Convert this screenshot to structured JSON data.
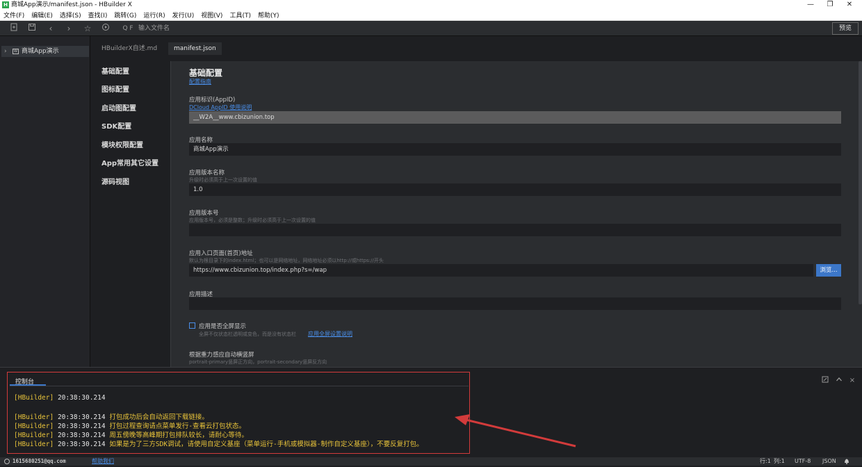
{
  "window": {
    "logo_text": "H",
    "title": "商城App演示/manifest.json - HBuilder X",
    "controls": [
      "—",
      "❐",
      "✕"
    ]
  },
  "menu": [
    "文件(F)",
    "编辑(E)",
    "选择(S)",
    "查找(I)",
    "跳转(G)",
    "运行(R)",
    "发行(U)",
    "视图(V)",
    "工具(T)",
    "帮助(Y)"
  ],
  "toolbar": {
    "search_shortcut": "Q F",
    "search_placeholder": "输入文件名",
    "preview_label": "预览"
  },
  "sidebar": {
    "project_name": "商城App演示",
    "folder_badge": "W"
  },
  "tabs": [
    {
      "label": "HBuilderX自述.md",
      "active": false
    },
    {
      "label": "manifest.json",
      "active": true
    }
  ],
  "settings_nav": [
    "基础配置",
    "图标配置",
    "启动图配置",
    "SDK配置",
    "模块权限配置",
    "App常用其它设置",
    "源码视图"
  ],
  "form": {
    "heading": "基础配置",
    "guide_link": "配置指南",
    "appid": {
      "label": "应用标识(AppID)",
      "link": "DCloud AppID 使用说明",
      "value": "__W2A__www.cbizunion.top"
    },
    "name": {
      "label": "应用名称",
      "value": "商城App演示"
    },
    "version_name": {
      "label": "应用版本名称",
      "hint": "升级时必须高于上一次设置的值",
      "value": "1.0"
    },
    "version_code": {
      "label": "应用版本号",
      "hint": "应用版本号，必须是整数；升级时必须高于上一次设置的值",
      "value": ""
    },
    "entry_url": {
      "label": "应用入口页面(首页)地址",
      "hint": "默认为根目录下的index.html；也可以是网络地址，网络地址必须以http://或https://开头",
      "value": "https://www.cbizunion.top/index.php?s=/wap",
      "browse_label": "浏览..."
    },
    "description": {
      "label": "应用描述",
      "value": ""
    },
    "fullscreen": {
      "label": "应用是否全屏显示",
      "hint": "全屏不仅状态栏透明或变色，而是没有状态栏",
      "link": "应用全屏设置说明",
      "checked": false
    },
    "orientation": {
      "label": "根据重力感应自动横竖屏",
      "hint": "portrait-primary竖屏正方向，portrait-secondary竖屏反方向"
    }
  },
  "console": {
    "tab_label": "控制台",
    "lines": [
      {
        "tag": "[HBuilder]",
        "time": "20:38:30.214",
        "msg": ""
      },
      {
        "tag": "[HBuilder]",
        "time": "20:38:30.214",
        "msg": "打包成功后会自动返回下载链接。"
      },
      {
        "tag": "[HBuilder]",
        "time": "20:38:30.214",
        "msg": "打包过程查询请点菜单发行-查看云打包状态。"
      },
      {
        "tag": "[HBuilder]",
        "time": "20:38:30.214",
        "msg": "周五傍晚等高峰期打包排队较长，请耐心等待。"
      },
      {
        "tag": "[HBuilder]",
        "time": "20:38:30.214",
        "msg": "如果是为了三方SDK调试，请使用自定义基座（菜单运行-手机或模拟器-制作自定义基座），不要反复打包。"
      }
    ]
  },
  "statusbar": {
    "user": "1615680251@qq.com",
    "help": "帮助我们",
    "line": "行:1",
    "col": "列:1",
    "encoding": "UTF-8",
    "language": "JSON"
  },
  "colors": {
    "accent": "#3c77c9",
    "link": "#4a8ee8",
    "console_text": "#e8c33a",
    "annotation_red": "#d23b3b"
  }
}
